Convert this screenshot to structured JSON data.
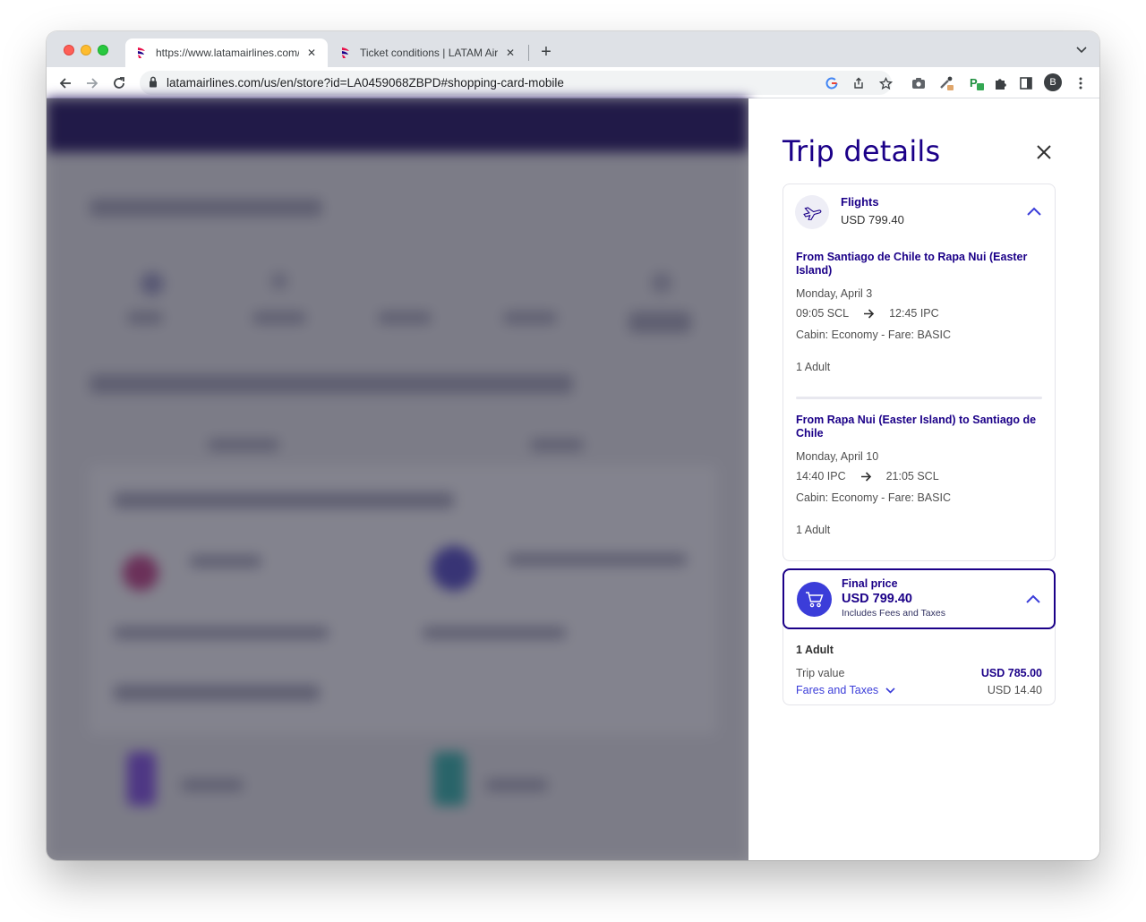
{
  "browser": {
    "tabs": [
      {
        "title": "https://www.latamairlines.com/",
        "active": true
      },
      {
        "title": "Ticket conditions | LATAM Airlin",
        "active": false
      }
    ],
    "url": "latamairlines.com/us/en/store?id=LA0459068ZBPD#shopping-card-mobile",
    "profile_initial": "B"
  },
  "trip_details": {
    "title": "Trip details",
    "flights": {
      "label": "Flights",
      "price": "USD 799.40",
      "segments": [
        {
          "route": "From Santiago de Chile to Rapa Nui (Easter Island)",
          "date": "Monday, April 3",
          "depart": "09:05 SCL",
          "arrive": "12:45 IPC",
          "cabin": "Cabin: Economy - Fare: BASIC",
          "passengers": "1 Adult"
        },
        {
          "route": "From Rapa Nui (Easter Island) to Santiago de Chile",
          "date": "Monday, April 10",
          "depart": "14:40 IPC",
          "arrive": "21:05 SCL",
          "cabin": "Cabin: Economy - Fare: BASIC",
          "passengers": "1 Adult"
        }
      ]
    },
    "final_price": {
      "label": "Final price",
      "value": "USD 799.40",
      "note": "Includes Fees and Taxes",
      "passengers": "1 Adult",
      "trip_value_label": "Trip value",
      "trip_value": "USD 785.00",
      "fares_label": "Fares and Taxes",
      "fares_value": "USD 14.40"
    }
  },
  "colors": {
    "brand_navy": "#1b0088",
    "accent_blue": "#3b3dd9",
    "header_dark": "#1b0c5a"
  }
}
